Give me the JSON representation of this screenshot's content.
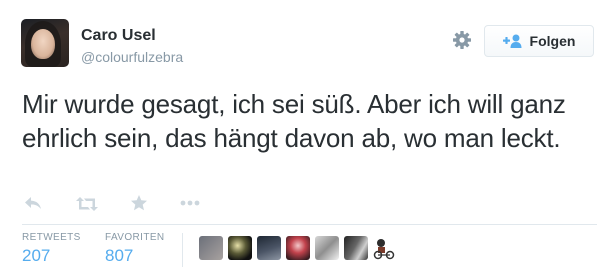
{
  "user": {
    "name": "Caro Usel",
    "handle": "@colourfulzebra"
  },
  "follow_button": {
    "label": "Folgen",
    "icon": "add-user-icon"
  },
  "settings_icon": "gear-icon",
  "tweet": {
    "text": "Mir wurde gesagt, ich sei süß. Aber ich will ganz ehrlich sein, das hängt davon ab, wo man leckt."
  },
  "actions": [
    {
      "name": "reply-icon"
    },
    {
      "name": "retweet-icon"
    },
    {
      "name": "favorite-icon"
    },
    {
      "name": "more-icon"
    }
  ],
  "stats": {
    "retweets": {
      "label": "RETWEETS",
      "count": "207"
    },
    "favorites": {
      "label": "FAVORITEN",
      "count": "807"
    }
  },
  "favorited_by_avatars": [
    "avatar-1",
    "avatar-2",
    "avatar-3",
    "avatar-4",
    "avatar-5",
    "avatar-6",
    "avatar-7"
  ],
  "colors": {
    "accent": "#55acee",
    "muted": "#8899a6",
    "text": "#292f33",
    "border": "#e1e8ed"
  }
}
